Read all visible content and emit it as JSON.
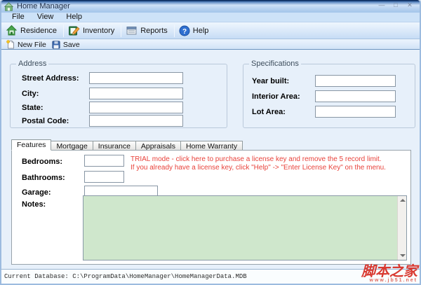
{
  "window": {
    "title": "Home Manager",
    "controls": {
      "minimize": "—",
      "maximize": "□",
      "close": "✕"
    }
  },
  "menu": {
    "items": [
      {
        "label": "File"
      },
      {
        "label": "View"
      },
      {
        "label": "Help"
      }
    ]
  },
  "toolbar": {
    "buttons": [
      {
        "label": "Residence",
        "icon": "residence-house-icon"
      },
      {
        "label": "Inventory",
        "icon": "inventory-notebook-icon"
      },
      {
        "label": "Reports",
        "icon": "reports-window-icon"
      },
      {
        "label": "Help",
        "icon": "help-question-icon"
      }
    ]
  },
  "file_toolbar": {
    "buttons": [
      {
        "label": "New File",
        "icon": "new-file-icon"
      },
      {
        "label": "Save",
        "icon": "save-floppy-icon"
      }
    ]
  },
  "address": {
    "title": "Address",
    "fields": [
      {
        "label": "Street Address:",
        "value": ""
      },
      {
        "label": "City:",
        "value": ""
      },
      {
        "label": "State:",
        "value": ""
      },
      {
        "label": "Postal Code:",
        "value": ""
      }
    ]
  },
  "specifications": {
    "title": "Specifications",
    "fields": [
      {
        "label": "Year built:",
        "value": ""
      },
      {
        "label": "Interior Area:",
        "value": ""
      },
      {
        "label": "Lot Area:",
        "value": ""
      }
    ]
  },
  "tabs": {
    "items": [
      {
        "label": "Features",
        "active": true
      },
      {
        "label": "Mortgage",
        "active": false
      },
      {
        "label": "Insurance",
        "active": false
      },
      {
        "label": "Appraisals",
        "active": false
      },
      {
        "label": "Home Warranty",
        "active": false
      }
    ]
  },
  "features": {
    "fields": [
      {
        "label": "Bedrooms:",
        "value": ""
      },
      {
        "label": "Bathrooms:",
        "value": ""
      },
      {
        "label": "Garage:",
        "value": ""
      }
    ],
    "trial_notice": {
      "line1": "TRIAL mode -  click here to purchase a license key and remove the 5 record limit.",
      "line2": "If you already have a license key, click \"Help\" -> \"Enter License Key\" on the menu."
    },
    "notes": {
      "label": "Notes:",
      "value": ""
    }
  },
  "statusbar": {
    "text": "Current Database: C:\\ProgramData\\HomeManager\\HomeManagerData.MDB"
  },
  "watermark": {
    "site_name": "脚本之家",
    "site_url": "www.jb51.net"
  },
  "colors": {
    "trial_text": "#e8423b",
    "notes_bg": "#cfe7cc",
    "titlebar_top": "#0d2f63",
    "watermark": "#d93a31"
  }
}
